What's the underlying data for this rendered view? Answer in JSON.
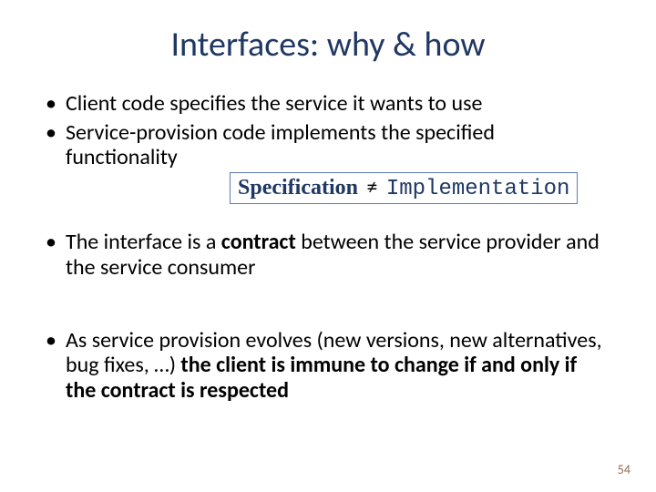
{
  "title": "Interfaces: why & how",
  "bullets": {
    "b1": "Client code specifies the service it wants to use",
    "b2": "Service-provision code implements the specified functionality",
    "b3a": "The interface is a ",
    "b3b": "contract",
    "b3c": " between the service provider and the service consumer",
    "b4a": "As service provision evolves (new versions, new alternatives, bug fixes, …) ",
    "b4b": "the client is immune to change if and only if the contract is respected"
  },
  "box": {
    "spec": "Specification",
    "ne": "≠",
    "impl": "Implementation"
  },
  "page": "54"
}
